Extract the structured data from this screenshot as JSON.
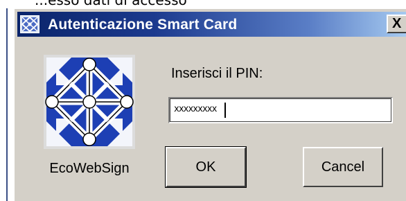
{
  "background": {
    "fragment_text": "...esso dati di accesso"
  },
  "window": {
    "title": "Autenticazione Smart Card",
    "title_icon": "smartcard-app-icon",
    "close_label": "X",
    "titlebar_color": "#0a246a",
    "face_color": "#d4d0c8"
  },
  "logo": {
    "icon": "ecowebsign-logo",
    "caption": "EcoWebSign",
    "colors": {
      "blue": "#1d3fb4",
      "white": "#ffffff"
    }
  },
  "pin": {
    "label": "Inserisci il PIN:",
    "masked_value": "xxxxxxxxx"
  },
  "buttons": {
    "ok": "OK",
    "cancel": "Cancel"
  }
}
